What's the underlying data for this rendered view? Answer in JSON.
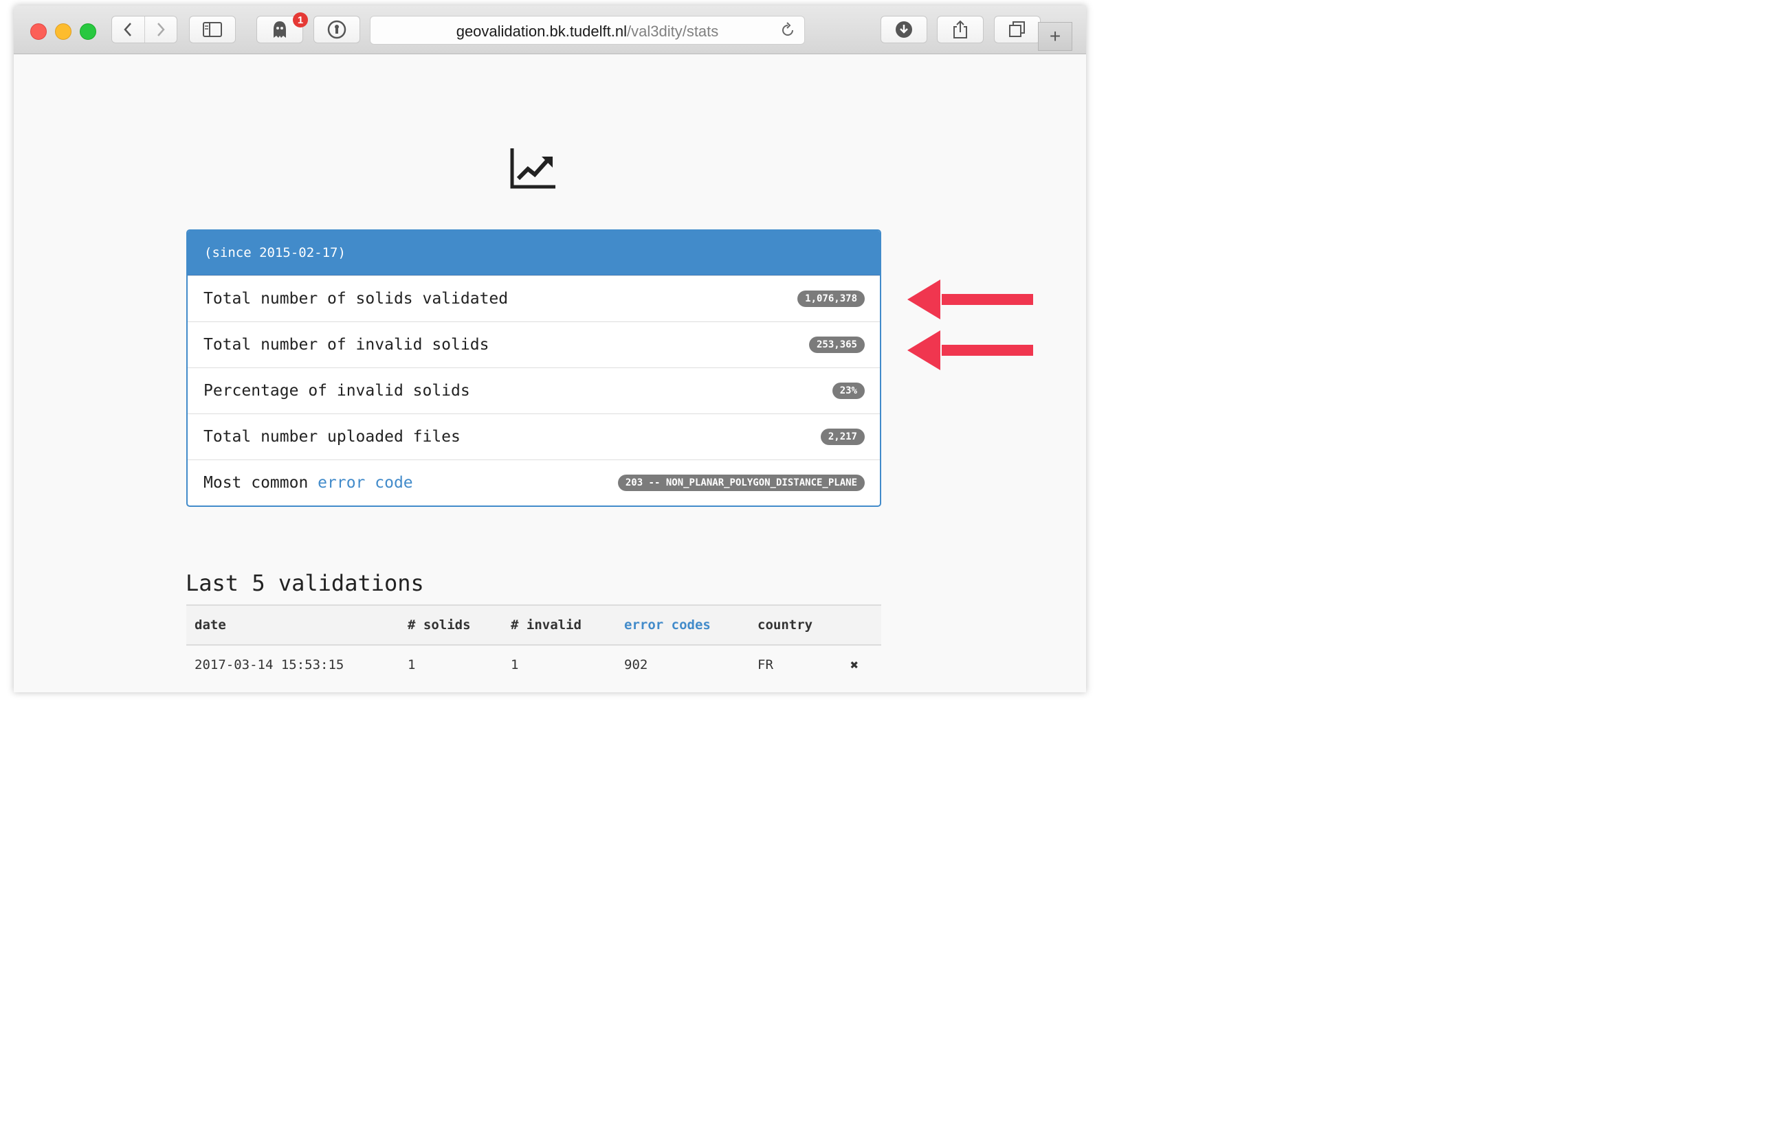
{
  "browser": {
    "url_host": "geovalidation.bk.tudelft.nl",
    "url_path": "/val3dity/stats",
    "extension_badge": "1",
    "new_tab_label": "+"
  },
  "page": {
    "icon": "line-chart-icon"
  },
  "stats": {
    "heading": "(since 2015-02-17)",
    "rows": [
      {
        "label": "Total number of solids validated",
        "value": "1,076,378"
      },
      {
        "label": "Total number of invalid solids",
        "value": "253,365"
      },
      {
        "label": "Percentage of invalid solids",
        "value": "23%"
      },
      {
        "label": "Total number uploaded files",
        "value": "2,217"
      }
    ],
    "common_error": {
      "label_prefix": "Most common ",
      "label_link": "error code",
      "value": "203 -- NON_PLANAR_POLYGON_DISTANCE_PLANE"
    }
  },
  "annotation_color": "#f0364f",
  "last_validations": {
    "title": "Last 5 validations",
    "columns": [
      "date",
      "# solids",
      "# invalid",
      "error codes",
      "country"
    ],
    "rows": [
      {
        "date": "2017-03-14 15:53:15",
        "solids": "1",
        "invalid": "1",
        "error_codes": "902",
        "country": "FR",
        "status": "✖"
      }
    ]
  }
}
